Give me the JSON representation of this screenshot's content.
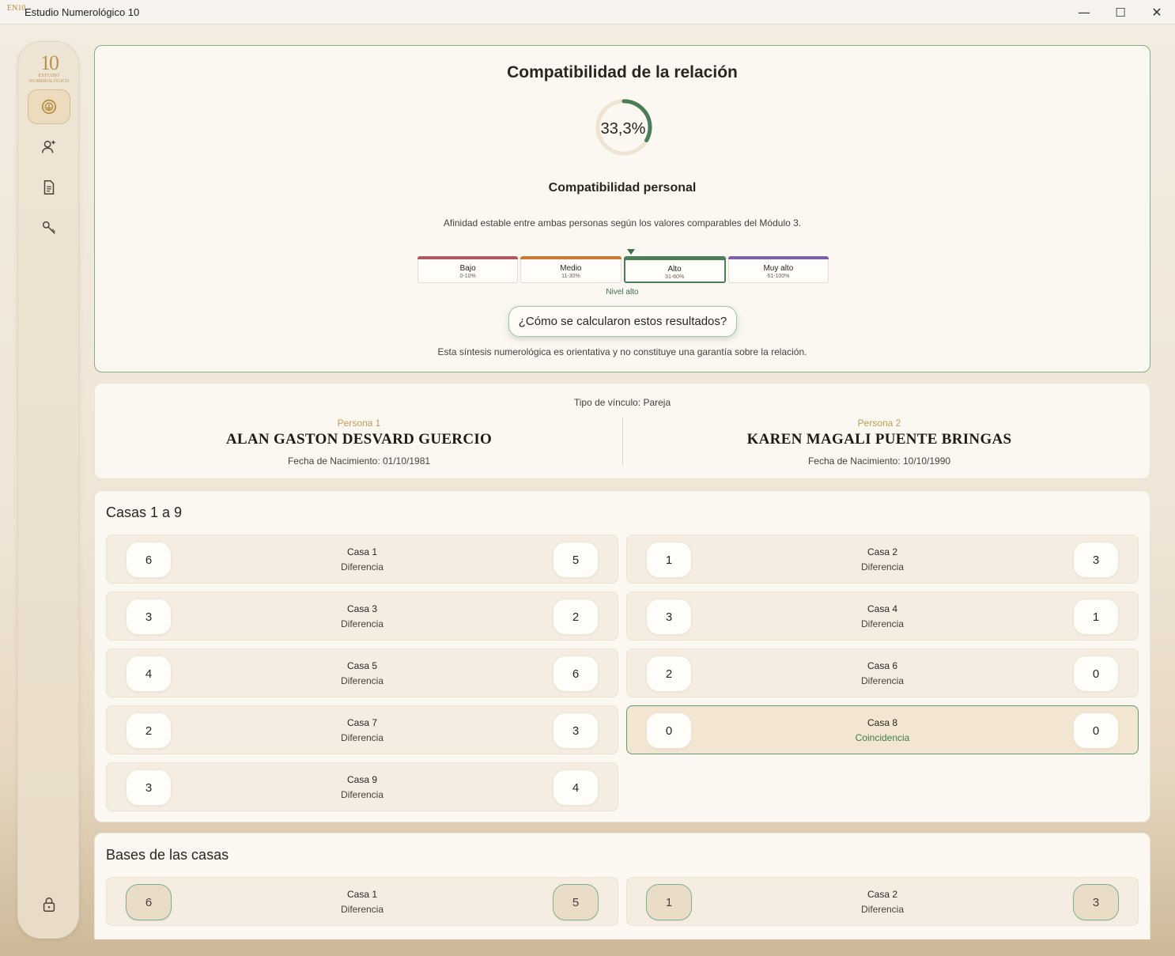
{
  "window": {
    "title": "Estudio Numerológico 10",
    "icon_text": "EN10",
    "minimize": "—",
    "maximize": "☐",
    "close": "✕"
  },
  "sidebar": {
    "logo": {
      "big": "10",
      "line1": "ESTUDIO",
      "line2": "NUMEROLÓGICO"
    },
    "items": [
      {
        "icon": "compatibility-icon",
        "active": true
      },
      {
        "icon": "user-add-icon",
        "active": false
      },
      {
        "icon": "document-icon",
        "active": false
      },
      {
        "icon": "key-icon",
        "active": false
      },
      {
        "icon": "lock-icon",
        "active": false
      }
    ]
  },
  "hero": {
    "title": "Compatibilidad de la relación",
    "percentage_text": "33,3%",
    "percentage_value": 33.3,
    "subtitle": "Compatibilidad personal",
    "description": "Afinidad estable entre ambas personas según los valores comparables del Módulo 3.",
    "scale": [
      {
        "name": "Bajo",
        "range": "0-10%",
        "color": "#b05a5f"
      },
      {
        "name": "Medio",
        "range": "11-30%",
        "color": "#c97a35"
      },
      {
        "name": "Alto",
        "range": "31-60%",
        "color": "#4c7d5b"
      },
      {
        "name": "Muy alto",
        "range": "61-100%",
        "color": "#7d60a8"
      }
    ],
    "active_level": "Alto",
    "level_label": "Nivel alto",
    "how_button": "¿Cómo se calcularon estos resultados?",
    "disclaimer": "Esta síntesis numerológica es orientativa y no constituye una garantía sobre la relación."
  },
  "people": {
    "bond": "Tipo de vínculo: Pareja",
    "p1": {
      "role": "Persona 1",
      "name": "ALAN GASTON DESVARD GUERCIO",
      "dob": "Fecha de Nacimiento: 01/10/1981"
    },
    "p2": {
      "role": "Persona 2",
      "name": "KAREN MAGALI PUENTE BRINGAS",
      "dob": "Fecha de Nacimiento: 10/10/1990"
    }
  },
  "houses": {
    "title": "Casas 1 a 9",
    "rows": [
      {
        "label": "Casa 1",
        "left": "6",
        "right": "5",
        "status": "Diferencia"
      },
      {
        "label": "Casa 2",
        "left": "1",
        "right": "3",
        "status": "Diferencia"
      },
      {
        "label": "Casa 3",
        "left": "3",
        "right": "2",
        "status": "Diferencia"
      },
      {
        "label": "Casa 4",
        "left": "3",
        "right": "1",
        "status": "Diferencia"
      },
      {
        "label": "Casa 5",
        "left": "4",
        "right": "6",
        "status": "Diferencia"
      },
      {
        "label": "Casa 6",
        "left": "2",
        "right": "0",
        "status": "Diferencia"
      },
      {
        "label": "Casa 7",
        "left": "2",
        "right": "3",
        "status": "Diferencia"
      },
      {
        "label": "Casa 8",
        "left": "0",
        "right": "0",
        "status": "Coincidencia"
      },
      {
        "label": "Casa 9",
        "left": "3",
        "right": "4",
        "status": "Diferencia"
      }
    ]
  },
  "bases": {
    "title": "Bases de las casas",
    "rows": [
      {
        "label": "Casa 1",
        "left": "6",
        "right": "5",
        "status": "Diferencia"
      },
      {
        "label": "Casa 2",
        "left": "1",
        "right": "3",
        "status": "Diferencia"
      }
    ]
  }
}
